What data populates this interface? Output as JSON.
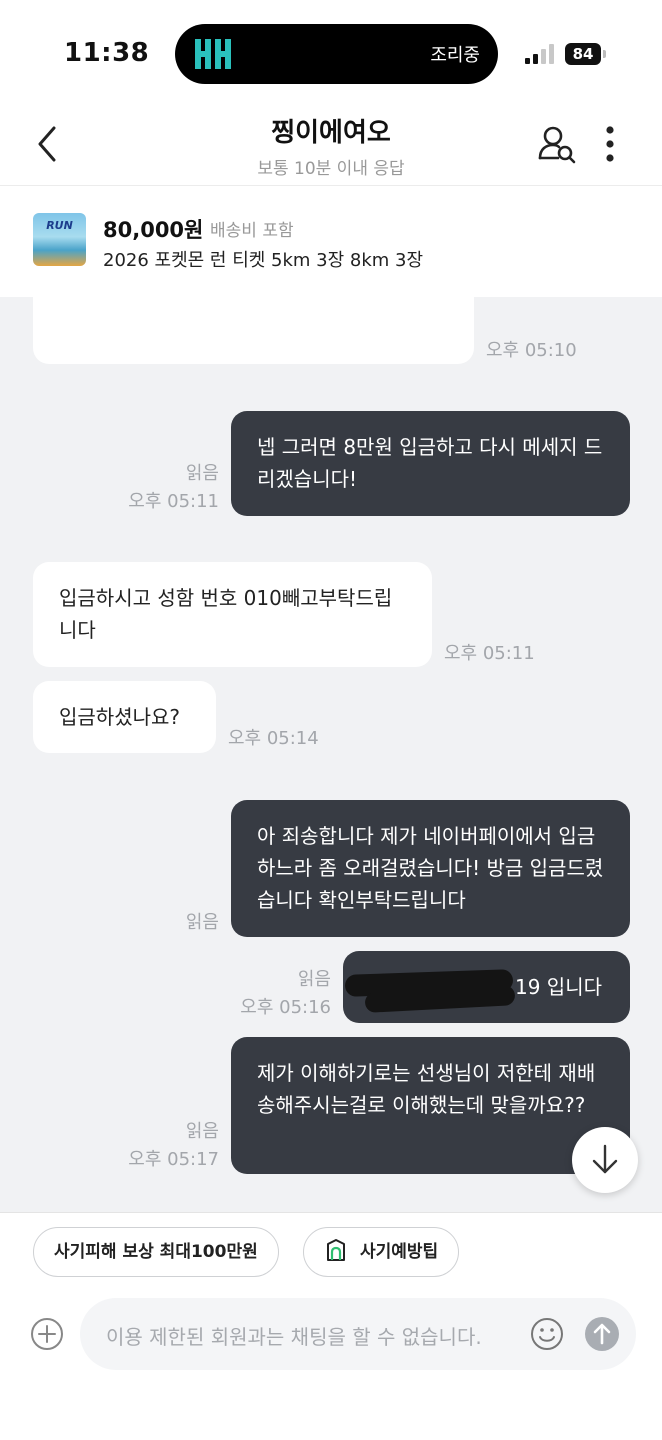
{
  "status_bar": {
    "time": "11:38",
    "island_text": "조리중",
    "battery": "84"
  },
  "header": {
    "title": "찡이에여오",
    "subtitle": "보통 10분 이내 응답"
  },
  "product": {
    "thumb_text": "RUN",
    "price": "80,000원",
    "shipping": "배송비 포함",
    "name": "2026 포켓몬 런 티켓 5km 3장 8km 3장"
  },
  "messages": [
    {
      "dir": "in",
      "text": "",
      "time": "오후 05:10"
    },
    {
      "dir": "out",
      "text": "넵 그러면 8만원 입금하고 다시 메세지 드리겠습니다!",
      "read": "읽음",
      "time": "오후 05:11"
    },
    {
      "dir": "in",
      "text": "입금하시고 성함 번호 010빼고부탁드립니다",
      "time": "오후 05:11"
    },
    {
      "dir": "in",
      "text": "입금하셨나요?",
      "time": "오후 05:14"
    },
    {
      "dir": "out",
      "text": "아 죄송합니다 제가 네이버페이에서 입금하느라 좀 오래걸렸습니다! 방금 입금드렸습니다 확인부탁드립니다",
      "read": "읽음",
      "time": ""
    },
    {
      "dir": "out",
      "text": "19 입니다",
      "read": "읽음",
      "time": "오후 05:16"
    },
    {
      "dir": "out",
      "text": "제가 이해하기로는 선생님이 저한테 재배송해주시는걸로 이해했는데 맞을까요??",
      "read": "읽음",
      "time": "오후 05:17"
    }
  ],
  "chips": {
    "fraud_comp": "사기피해 보상 최대100만원",
    "fraud_tips": "사기예방팁"
  },
  "input": {
    "placeholder": "이용 제한된 회원과는 채팅을 할 수 없습니다."
  },
  "icons": {
    "back": "chevron-left-icon",
    "profile": "user-search-icon",
    "more": "more-vertical-icon",
    "scroll_down": "arrow-down-icon",
    "plus": "plus-circle-icon",
    "emoji": "smile-icon",
    "send": "arrow-up-icon",
    "tips": "shield-icon"
  },
  "colors": {
    "outgoing_bubble": "#373b43",
    "chat_bg": "#f1f2f4",
    "tip_icon": "#2fbf71"
  }
}
